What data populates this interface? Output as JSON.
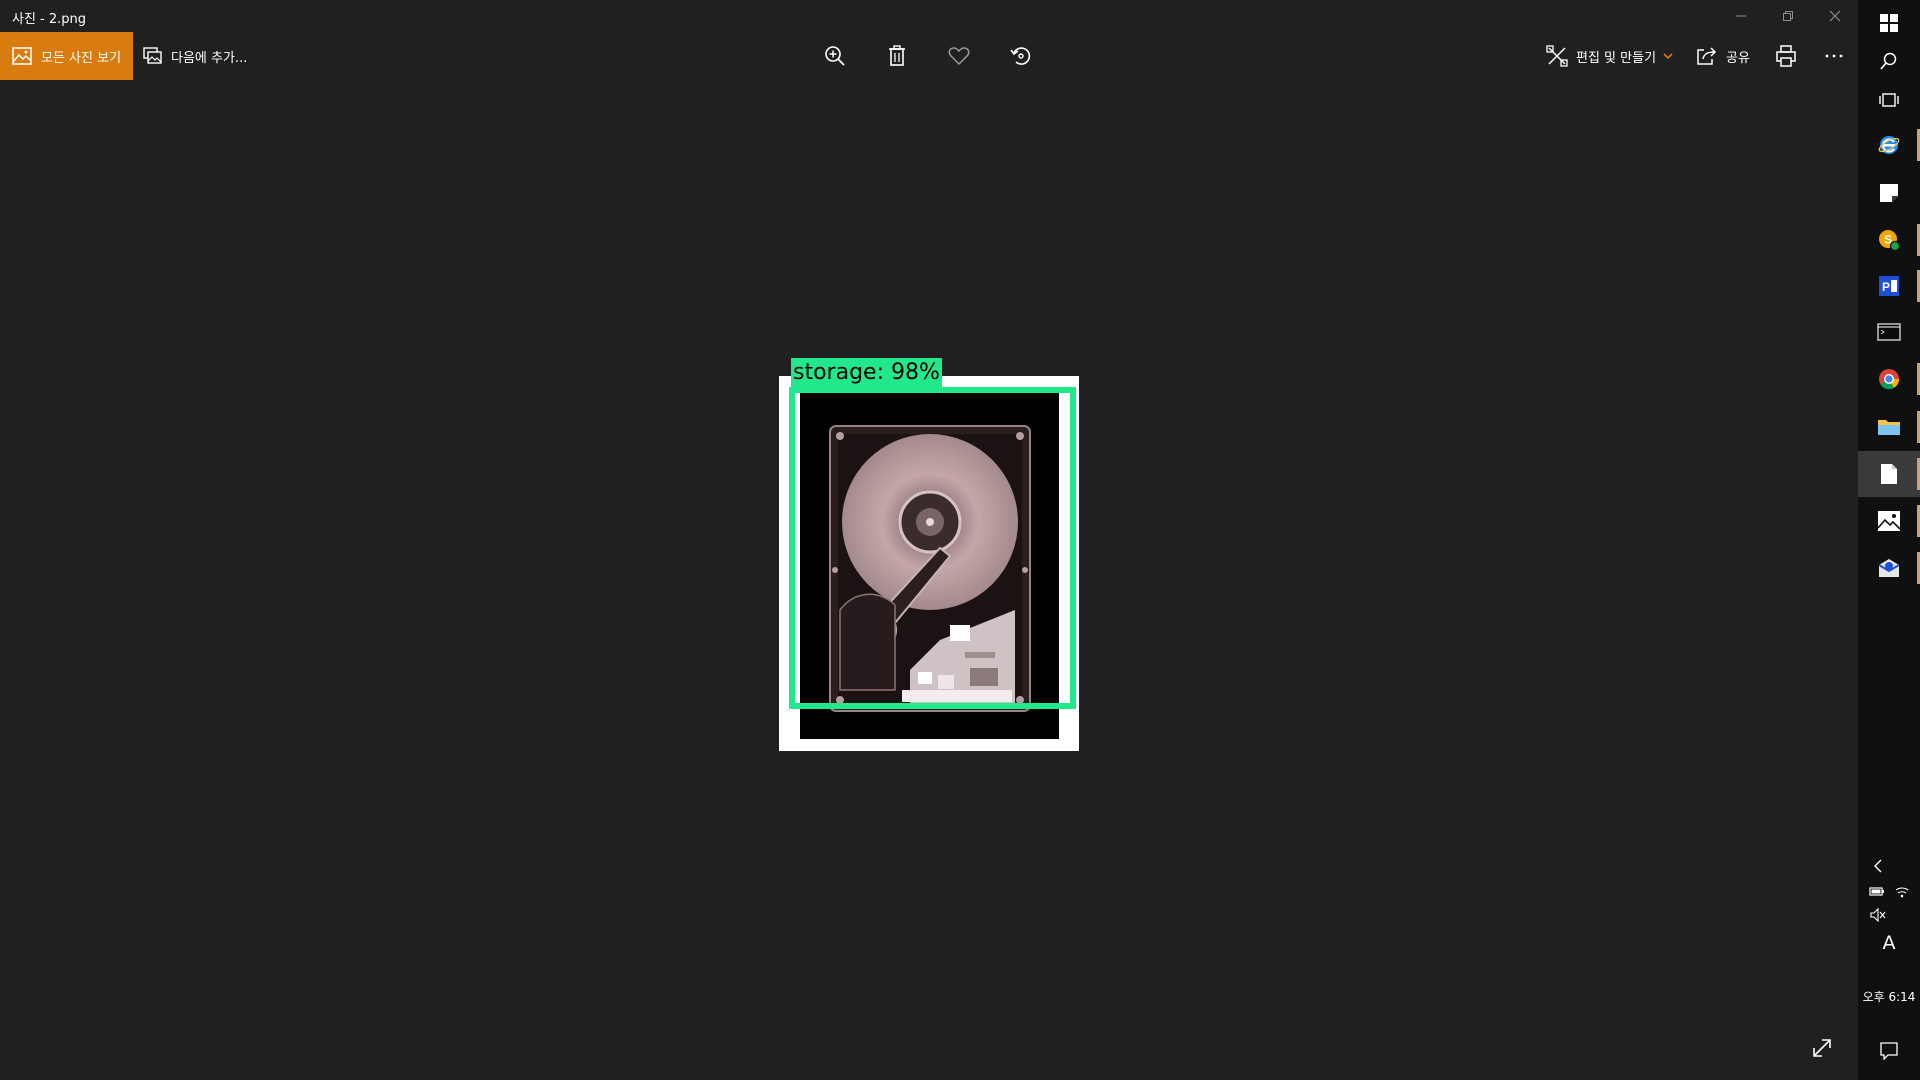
{
  "window": {
    "title": "사진 - 2.png"
  },
  "toolbar": {
    "all_photos_label": "모든 사진 보기",
    "add_to_label": "다음에 추가...",
    "edit_label": "편집 및 만들기",
    "share_label": "공유",
    "tools": [
      "zoom-in-icon",
      "delete-icon",
      "favorite-icon",
      "rotate-icon"
    ],
    "right_tools": [
      "print-icon",
      "more-icon"
    ]
  },
  "photo": {
    "detection_label": "storage: 98%",
    "detection_color": "#21e88a"
  },
  "taskbar": {
    "items": [
      "start-icon",
      "search-icon",
      "task-view-icon",
      "internet-explorer-icon",
      "sticky-notes-icon",
      "skype-icon",
      "project-icon",
      "terminal-icon",
      "chrome-icon",
      "file-explorer-icon",
      "notepad-icon",
      "photos-icon",
      "outlook-icon"
    ],
    "active_item": "notepad-icon",
    "ime_label": "A",
    "clock": "오후 6:14"
  },
  "colors": {
    "accent": "#d97b0e",
    "background": "#202020",
    "taskbar": "#101010"
  }
}
